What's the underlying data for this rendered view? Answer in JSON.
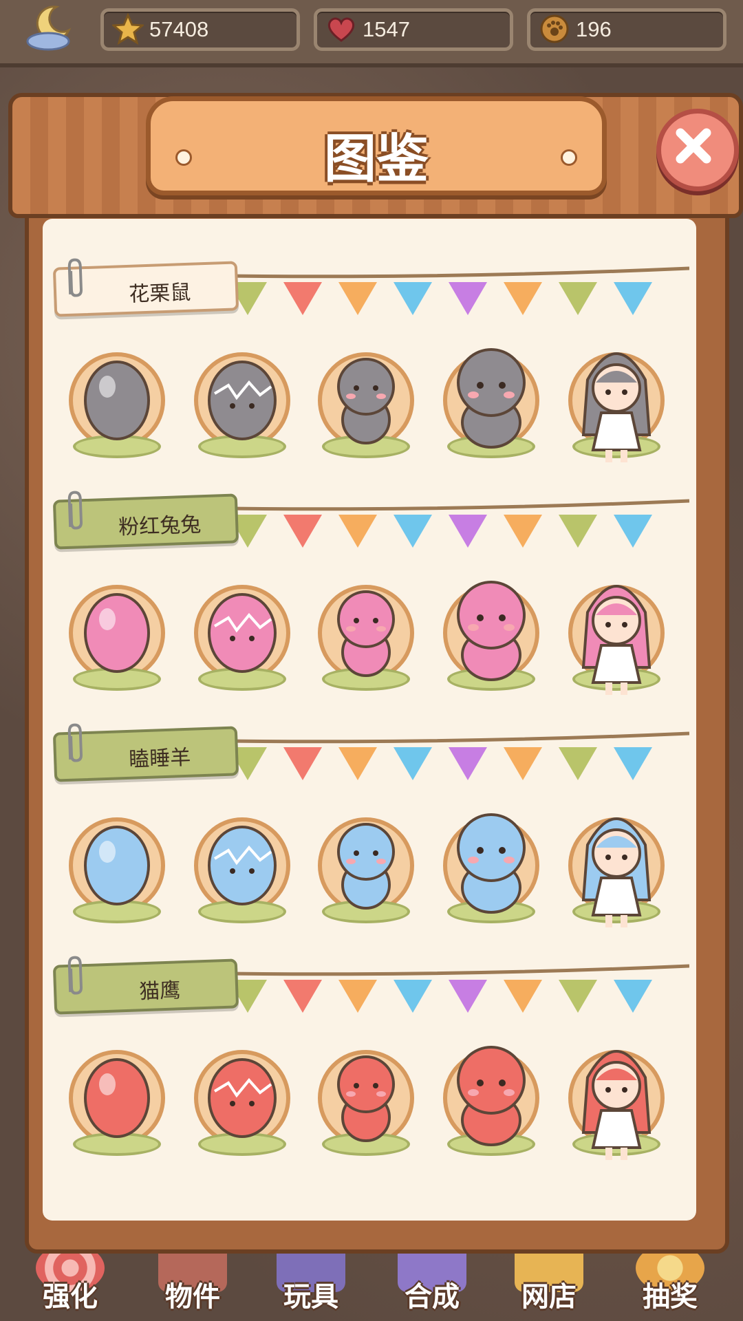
{
  "resources": [
    {
      "icon": "star-icon",
      "value": "57408",
      "color": "#e9b54a"
    },
    {
      "icon": "heart-icon",
      "value": "1547",
      "color": "#c9474f"
    },
    {
      "icon": "paw-coin-icon",
      "value": "196",
      "color": "#c98b3c"
    }
  ],
  "panel": {
    "title": "图鉴"
  },
  "collections": [
    {
      "label": "花栗鼠",
      "tag_style": "beige",
      "theme": "#8f8b90",
      "stages": [
        "egg",
        "hatching",
        "baby",
        "adult",
        "girl"
      ]
    },
    {
      "label": "粉红兔兔",
      "tag_style": "green",
      "theme": "#f08bb7",
      "stages": [
        "egg",
        "hatching",
        "baby",
        "adult",
        "girl"
      ]
    },
    {
      "label": "瞌睡羊",
      "tag_style": "green",
      "theme": "#9ccbf0",
      "stages": [
        "egg",
        "hatching",
        "baby",
        "adult",
        "girl"
      ]
    },
    {
      "label": "猫鹰",
      "tag_style": "green",
      "theme": "#ee6e66",
      "stages": [
        "egg",
        "hatching",
        "baby",
        "adult",
        "girl"
      ]
    }
  ],
  "bottom_nav": [
    {
      "label": "强化",
      "color": "#e0635f"
    },
    {
      "label": "物件",
      "color": "#b5685a"
    },
    {
      "label": "玩具",
      "color": "#7e6fb8"
    },
    {
      "label": "合成",
      "color": "#8e78c8"
    },
    {
      "label": "网店",
      "color": "#e7b454"
    },
    {
      "label": "抽奖",
      "color": "#e7a54a"
    }
  ]
}
